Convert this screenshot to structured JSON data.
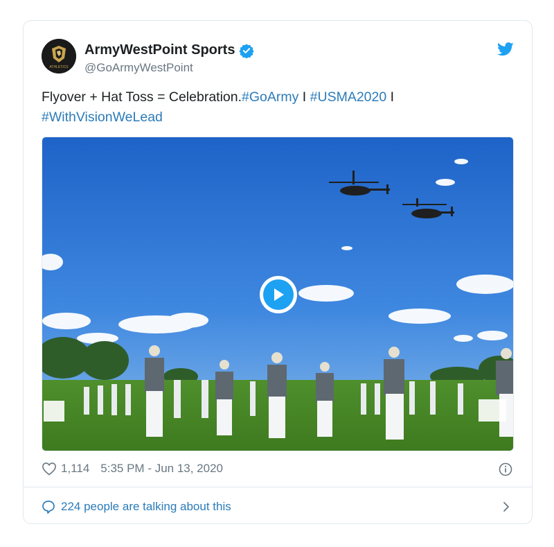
{
  "tweet": {
    "display_name": "ArmyWestPoint Sports",
    "handle": "@GoArmyWestPoint",
    "avatar_label": "ATHLETICS",
    "text_parts": [
      {
        "text": "Flyover + Hat Toss = Celebration.",
        "tag": false
      },
      {
        "text": "#GoArmy",
        "tag": true
      },
      {
        "text": " I ",
        "tag": false
      },
      {
        "text": "#USMA2020",
        "tag": true
      },
      {
        "text": " I ",
        "tag": false
      },
      {
        "text": "#WithVisionWeLead",
        "tag": true
      }
    ],
    "likes": "1,114",
    "timestamp": "5:35 PM - Jun 13, 2020",
    "talking": "224 people are talking about this"
  },
  "icons": {
    "verified": "verified-badge-icon",
    "bird": "twitter-bird-icon",
    "play": "play-icon",
    "heart": "heart-icon",
    "info": "info-icon",
    "comment": "comment-bubble-icon",
    "chevron": "chevron-right-icon"
  },
  "colors": {
    "link": "#2b7bb9",
    "brand": "#1da1f2",
    "muted": "#697882",
    "text": "#1c2022"
  }
}
